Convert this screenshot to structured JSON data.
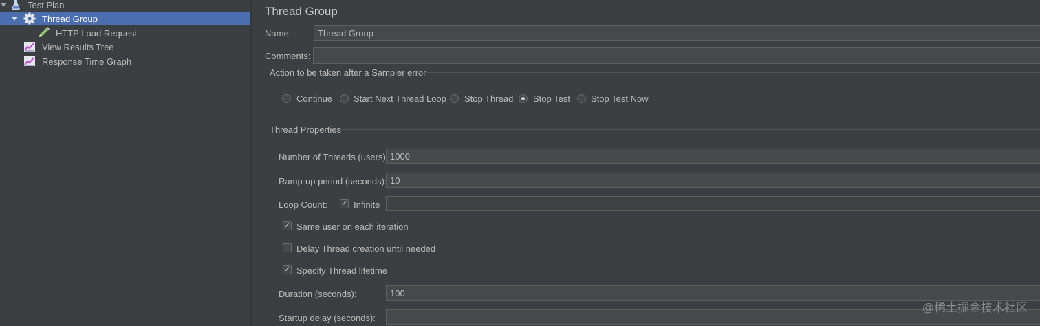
{
  "tree": {
    "items": [
      {
        "label": "Test Plan",
        "icon": "flask-icon"
      },
      {
        "label": "Thread Group",
        "icon": "gear-icon"
      },
      {
        "label": "HTTP Load Request",
        "icon": "pen-icon"
      },
      {
        "label": "View Results Tree",
        "icon": "graph-icon"
      },
      {
        "label": "Response Time Graph",
        "icon": "graph-icon"
      }
    ]
  },
  "panel": {
    "title": "Thread Group",
    "name_label": "Name:",
    "name_value": "Thread Group",
    "comments_label": "Comments:",
    "comments_value": "",
    "sampler_error": {
      "heading": "Action to be taken after a Sampler error",
      "options": [
        "Continue",
        "Start Next Thread Loop",
        "Stop Thread",
        "Stop Test",
        "Stop Test Now"
      ],
      "selected": "Stop Test"
    },
    "thread_props": {
      "heading": "Thread Properties",
      "threads_label": "Number of Threads (users):",
      "threads_value": "1000",
      "rampup_label": "Ramp-up period (seconds):",
      "rampup_value": "10",
      "loop_label": "Loop Count:",
      "infinite_label": "Infinite",
      "infinite_checked": true,
      "loop_value": "",
      "same_user_label": "Same user on each iteration",
      "same_user_checked": true,
      "delay_label": "Delay Thread creation until needed",
      "delay_checked": false,
      "lifetime_label": "Specify Thread lifetime",
      "lifetime_checked": true,
      "duration_label": "Duration (seconds):",
      "duration_value": "100",
      "startup_label": "Startup delay (seconds):",
      "startup_value": ""
    }
  },
  "watermark": "@稀土掘金技术社区",
  "colors": {
    "selection": "#4b6eaf",
    "background": "#3c3f41",
    "field": "#45494a"
  }
}
